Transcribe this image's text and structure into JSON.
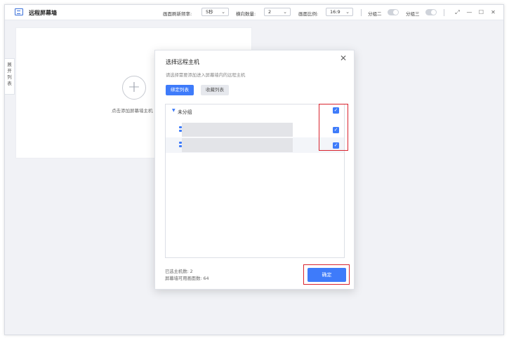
{
  "app": {
    "title": "远程屏幕墙",
    "icon": "screen-wall-icon"
  },
  "toolbar": {
    "refresh_label": "画面刷新频率:",
    "refresh_value": "5秒",
    "columns_label": "横向数量:",
    "columns_value": "2",
    "ratio_label": "画面比例:",
    "ratio_value": "16:9",
    "split2_label": "分组二",
    "split3_label": "分组三"
  },
  "window_controls": [
    "restore-icon",
    "minimize-icon",
    "maximize-icon",
    "close-icon"
  ],
  "sidebar_tab": {
    "lines": [
      "展",
      "开",
      "列",
      "表"
    ]
  },
  "screen_card": {
    "add_text": "点击添加屏幕墙主机"
  },
  "dialog": {
    "title": "选择远程主机",
    "hint": "请选择需要添加进入屏幕墙内的远程主机",
    "tabs": [
      {
        "label": "绑定列表",
        "active": true
      },
      {
        "label": "收藏列表",
        "active": false
      }
    ],
    "group": {
      "label": "未分组",
      "checked": true
    },
    "hosts": [
      {
        "checked": true
      },
      {
        "checked": true
      }
    ],
    "selected_label": "已选主机数: 2",
    "available_label": "屏幕墙可用画面数: 64",
    "confirm_label": "确定"
  },
  "colors": {
    "accent": "#3e7bfa",
    "highlight": "#d9232e"
  }
}
